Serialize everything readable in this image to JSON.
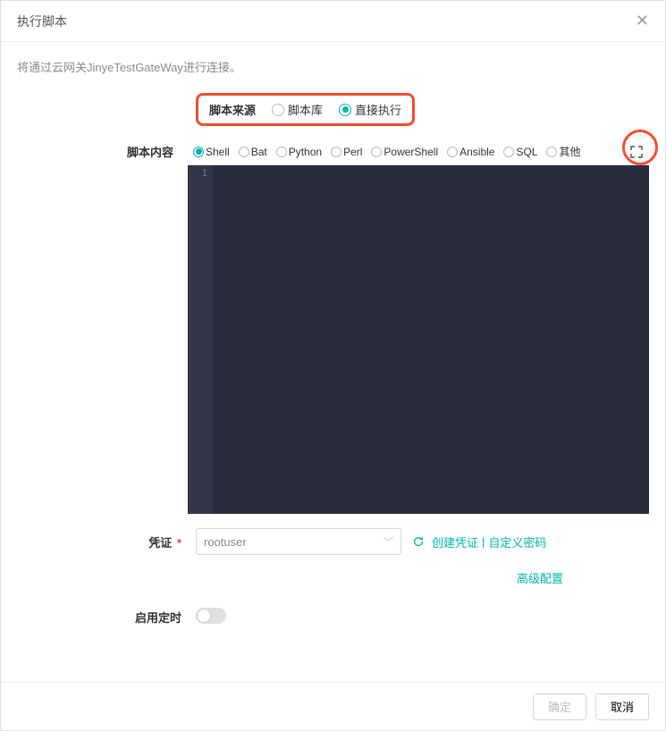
{
  "header": {
    "title": "执行脚本"
  },
  "subtitle": "将通过云网关JinyeTestGateWay进行连接。",
  "source": {
    "label": "脚本来源",
    "options": [
      {
        "label": "脚本库",
        "selected": false
      },
      {
        "label": "直接执行",
        "selected": true
      }
    ]
  },
  "content": {
    "label": "脚本内容",
    "languages": [
      {
        "label": "Shell",
        "selected": true
      },
      {
        "label": "Bat",
        "selected": false
      },
      {
        "label": "Python",
        "selected": false
      },
      {
        "label": "Perl",
        "selected": false
      },
      {
        "label": "PowerShell",
        "selected": false
      },
      {
        "label": "Ansible",
        "selected": false
      },
      {
        "label": "SQL",
        "selected": false
      },
      {
        "label": "其他",
        "selected": false
      }
    ],
    "gutter_line": "1"
  },
  "credentials": {
    "label": "凭证",
    "required": "*",
    "value": "rootuser",
    "create_label": "创建凭证",
    "divider": "|",
    "custom_pw_label": "自定义密码"
  },
  "advanced": {
    "label": "高级配置"
  },
  "schedule": {
    "label": "启用定时"
  },
  "footer": {
    "ok": "确定",
    "cancel": "取消"
  }
}
